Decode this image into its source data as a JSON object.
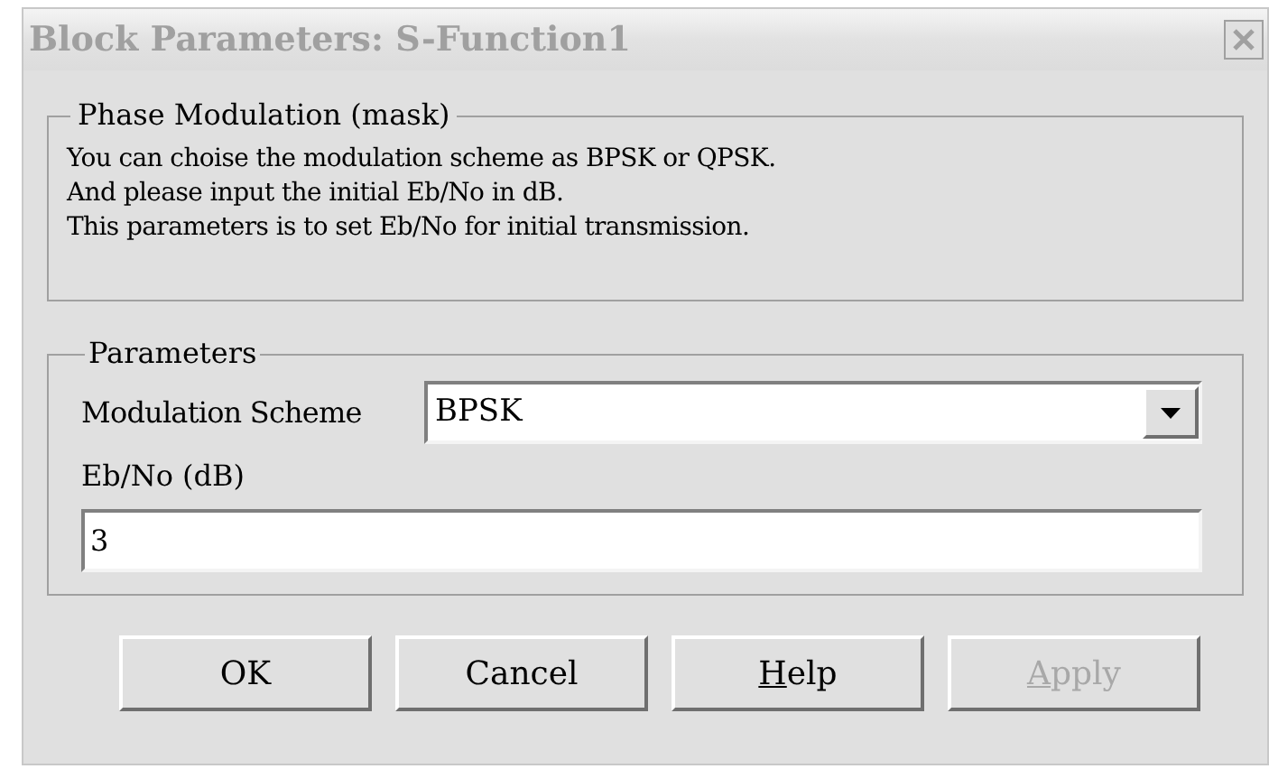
{
  "window": {
    "title": "Block Parameters: S-Function1",
    "active": false
  },
  "description_group": {
    "title": "Phase Modulation (mask)",
    "lines": [
      "You can choise the modulation scheme as BPSK or QPSK.",
      "And please input the initial Eb/No in dB.",
      "This parameters is to set Eb/No for initial transmission."
    ]
  },
  "parameters_group": {
    "title": "Parameters",
    "modulation": {
      "label": "Modulation Scheme",
      "value": "BPSK"
    },
    "ebno": {
      "label": "Eb/No (dB)",
      "value": "3"
    }
  },
  "buttons": [
    {
      "label": "OK",
      "disabled": false,
      "underline_first": false
    },
    {
      "label": "Cancel",
      "disabled": false,
      "underline_first": false
    },
    {
      "label": "Help",
      "disabled": false,
      "underline_first": true
    },
    {
      "label": "Apply",
      "disabled": true,
      "underline_first": true
    }
  ]
}
